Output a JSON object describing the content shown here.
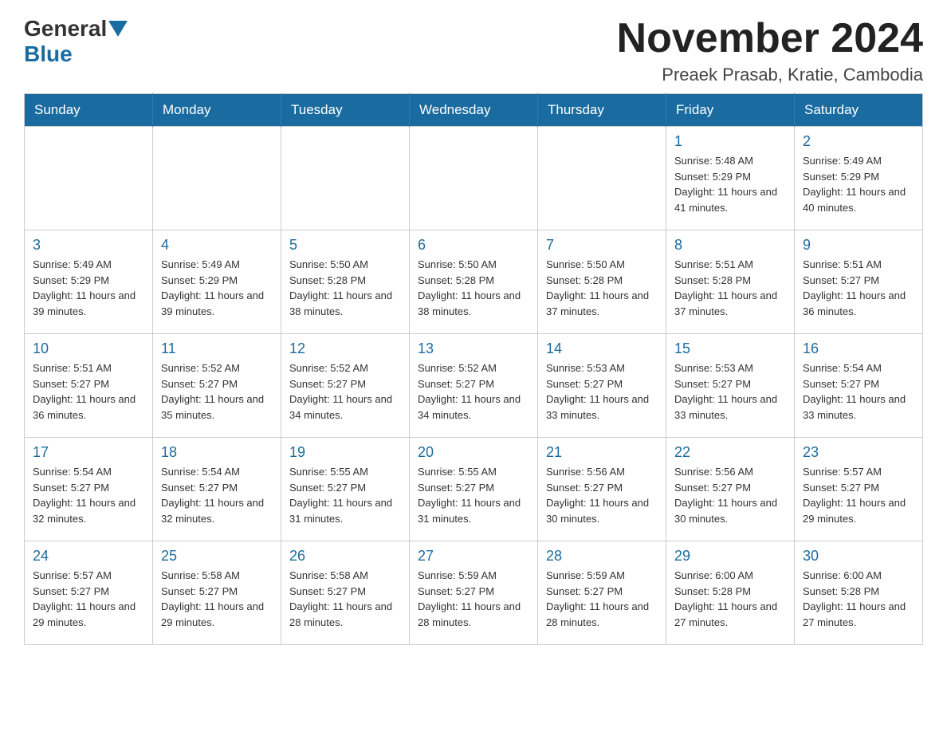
{
  "header": {
    "logo_general": "General",
    "logo_blue": "Blue",
    "month_title": "November 2024",
    "location": "Preaek Prasab, Kratie, Cambodia"
  },
  "weekdays": [
    "Sunday",
    "Monday",
    "Tuesday",
    "Wednesday",
    "Thursday",
    "Friday",
    "Saturday"
  ],
  "weeks": [
    [
      {
        "day": "",
        "info": ""
      },
      {
        "day": "",
        "info": ""
      },
      {
        "day": "",
        "info": ""
      },
      {
        "day": "",
        "info": ""
      },
      {
        "day": "",
        "info": ""
      },
      {
        "day": "1",
        "info": "Sunrise: 5:48 AM\nSunset: 5:29 PM\nDaylight: 11 hours and 41 minutes."
      },
      {
        "day": "2",
        "info": "Sunrise: 5:49 AM\nSunset: 5:29 PM\nDaylight: 11 hours and 40 minutes."
      }
    ],
    [
      {
        "day": "3",
        "info": "Sunrise: 5:49 AM\nSunset: 5:29 PM\nDaylight: 11 hours and 39 minutes."
      },
      {
        "day": "4",
        "info": "Sunrise: 5:49 AM\nSunset: 5:29 PM\nDaylight: 11 hours and 39 minutes."
      },
      {
        "day": "5",
        "info": "Sunrise: 5:50 AM\nSunset: 5:28 PM\nDaylight: 11 hours and 38 minutes."
      },
      {
        "day": "6",
        "info": "Sunrise: 5:50 AM\nSunset: 5:28 PM\nDaylight: 11 hours and 38 minutes."
      },
      {
        "day": "7",
        "info": "Sunrise: 5:50 AM\nSunset: 5:28 PM\nDaylight: 11 hours and 37 minutes."
      },
      {
        "day": "8",
        "info": "Sunrise: 5:51 AM\nSunset: 5:28 PM\nDaylight: 11 hours and 37 minutes."
      },
      {
        "day": "9",
        "info": "Sunrise: 5:51 AM\nSunset: 5:27 PM\nDaylight: 11 hours and 36 minutes."
      }
    ],
    [
      {
        "day": "10",
        "info": "Sunrise: 5:51 AM\nSunset: 5:27 PM\nDaylight: 11 hours and 36 minutes."
      },
      {
        "day": "11",
        "info": "Sunrise: 5:52 AM\nSunset: 5:27 PM\nDaylight: 11 hours and 35 minutes."
      },
      {
        "day": "12",
        "info": "Sunrise: 5:52 AM\nSunset: 5:27 PM\nDaylight: 11 hours and 34 minutes."
      },
      {
        "day": "13",
        "info": "Sunrise: 5:52 AM\nSunset: 5:27 PM\nDaylight: 11 hours and 34 minutes."
      },
      {
        "day": "14",
        "info": "Sunrise: 5:53 AM\nSunset: 5:27 PM\nDaylight: 11 hours and 33 minutes."
      },
      {
        "day": "15",
        "info": "Sunrise: 5:53 AM\nSunset: 5:27 PM\nDaylight: 11 hours and 33 minutes."
      },
      {
        "day": "16",
        "info": "Sunrise: 5:54 AM\nSunset: 5:27 PM\nDaylight: 11 hours and 33 minutes."
      }
    ],
    [
      {
        "day": "17",
        "info": "Sunrise: 5:54 AM\nSunset: 5:27 PM\nDaylight: 11 hours and 32 minutes."
      },
      {
        "day": "18",
        "info": "Sunrise: 5:54 AM\nSunset: 5:27 PM\nDaylight: 11 hours and 32 minutes."
      },
      {
        "day": "19",
        "info": "Sunrise: 5:55 AM\nSunset: 5:27 PM\nDaylight: 11 hours and 31 minutes."
      },
      {
        "day": "20",
        "info": "Sunrise: 5:55 AM\nSunset: 5:27 PM\nDaylight: 11 hours and 31 minutes."
      },
      {
        "day": "21",
        "info": "Sunrise: 5:56 AM\nSunset: 5:27 PM\nDaylight: 11 hours and 30 minutes."
      },
      {
        "day": "22",
        "info": "Sunrise: 5:56 AM\nSunset: 5:27 PM\nDaylight: 11 hours and 30 minutes."
      },
      {
        "day": "23",
        "info": "Sunrise: 5:57 AM\nSunset: 5:27 PM\nDaylight: 11 hours and 29 minutes."
      }
    ],
    [
      {
        "day": "24",
        "info": "Sunrise: 5:57 AM\nSunset: 5:27 PM\nDaylight: 11 hours and 29 minutes."
      },
      {
        "day": "25",
        "info": "Sunrise: 5:58 AM\nSunset: 5:27 PM\nDaylight: 11 hours and 29 minutes."
      },
      {
        "day": "26",
        "info": "Sunrise: 5:58 AM\nSunset: 5:27 PM\nDaylight: 11 hours and 28 minutes."
      },
      {
        "day": "27",
        "info": "Sunrise: 5:59 AM\nSunset: 5:27 PM\nDaylight: 11 hours and 28 minutes."
      },
      {
        "day": "28",
        "info": "Sunrise: 5:59 AM\nSunset: 5:27 PM\nDaylight: 11 hours and 28 minutes."
      },
      {
        "day": "29",
        "info": "Sunrise: 6:00 AM\nSunset: 5:28 PM\nDaylight: 11 hours and 27 minutes."
      },
      {
        "day": "30",
        "info": "Sunrise: 6:00 AM\nSunset: 5:28 PM\nDaylight: 11 hours and 27 minutes."
      }
    ]
  ]
}
